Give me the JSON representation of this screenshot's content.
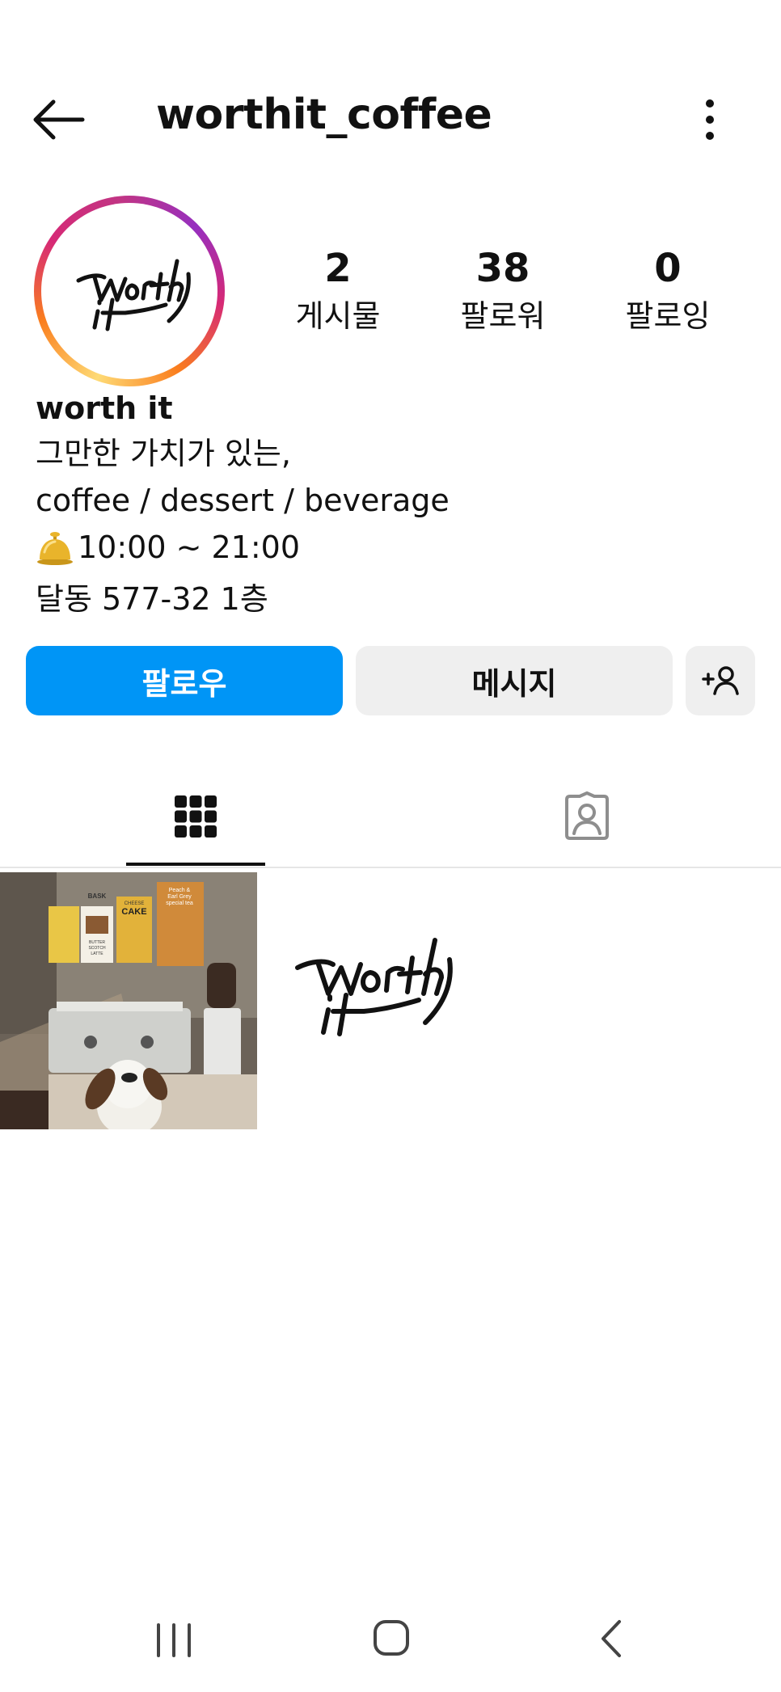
{
  "header": {
    "title": "worthit_coffee",
    "back_icon": "arrow-left-icon",
    "more_icon": "more-vertical-icon"
  },
  "profile": {
    "avatar_text": "worth it",
    "stats": [
      {
        "value": "2",
        "label": "게시물"
      },
      {
        "value": "38",
        "label": "팔로워"
      },
      {
        "value": "0",
        "label": "팔로잉"
      }
    ],
    "display_name": "worth it",
    "bio_lines": [
      "그만한 가치가 있는,",
      "coffee / dessert / beverage"
    ],
    "hours": "10:00 ~ 21:00",
    "address": "달동 577-32 1층"
  },
  "actions": {
    "follow_label": "팔로우",
    "message_label": "메시지",
    "add_person_icon": "add-person-icon"
  },
  "tabs": [
    {
      "icon": "grid-icon",
      "active": true
    },
    {
      "icon": "tagged-person-icon",
      "active": false
    }
  ],
  "posts": [
    {
      "type": "photo",
      "sign_texts": [
        "BASK",
        "CHEESE",
        "CAKE",
        "Peach &",
        "Earl Grey",
        "special tea",
        "BUTTER",
        "SCOTCH",
        "LATTE"
      ]
    },
    {
      "type": "logo",
      "logo_text": "worth it"
    }
  ],
  "colors": {
    "accent": "#0095f6",
    "secondary_button": "#efefef",
    "text": "#111111"
  },
  "system_nav": [
    "recent-apps-icon",
    "home-icon",
    "back-icon"
  ]
}
